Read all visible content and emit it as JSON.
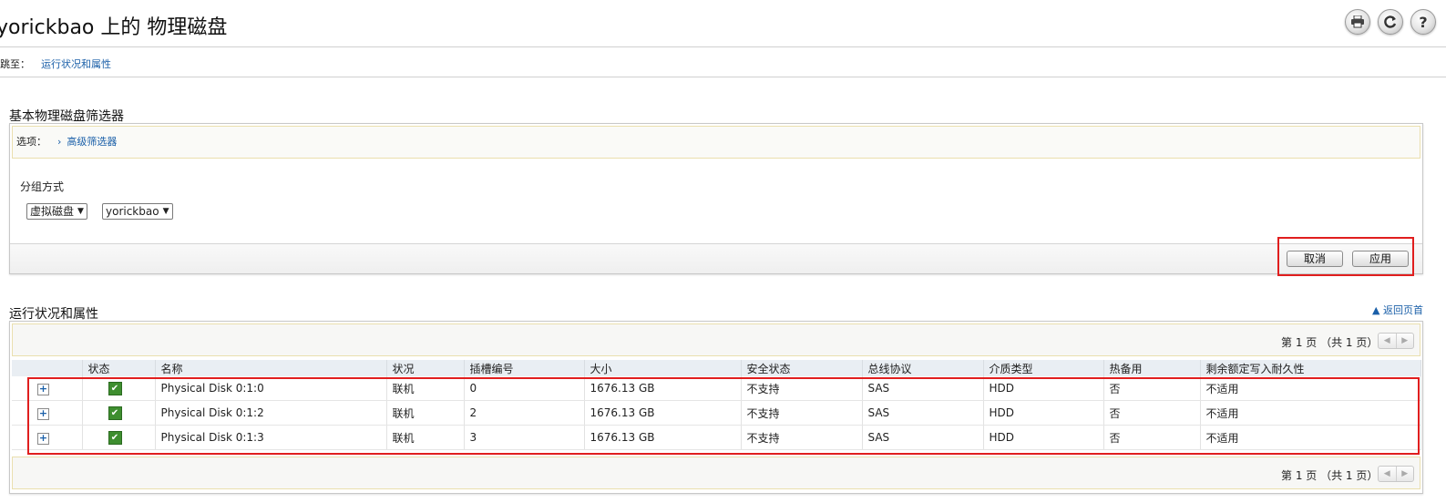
{
  "header": {
    "title": "yorickbao 上的 物理磁盘",
    "icons": [
      "printer-icon",
      "refresh-icon",
      "help-icon"
    ]
  },
  "jump": {
    "label": "跳至：",
    "link": "运行状况和属性"
  },
  "filter": {
    "title": "基本物理磁盘筛选器",
    "options_label": "选项：",
    "advanced_link": "高级筛选器",
    "group_label": "分组方式",
    "group_select": "虚拟磁盘",
    "disk_select": "yorickbao",
    "cancel_label": "取消",
    "apply_label": "应用"
  },
  "health": {
    "title": "运行状况和属性",
    "back_to_top": "▲ 返回页首",
    "pager_text": "第 1 页 （共 1 页）",
    "columns": [
      "",
      "状态",
      "名称",
      "状况",
      "插槽编号",
      "大小",
      "安全状态",
      "总线协议",
      "介质类型",
      "热备用",
      "剩余额定写入耐久性"
    ],
    "rows": [
      {
        "name": "Physical Disk 0:1:0",
        "state": "联机",
        "slot": "0",
        "size": "1676.13 GB",
        "security": "不支持",
        "bus": "SAS",
        "media": "HDD",
        "hotspare": "否",
        "endurance": "不适用"
      },
      {
        "name": "Physical Disk 0:1:2",
        "state": "联机",
        "slot": "2",
        "size": "1676.13 GB",
        "security": "不支持",
        "bus": "SAS",
        "media": "HDD",
        "hotspare": "否",
        "endurance": "不适用"
      },
      {
        "name": "Physical Disk 0:1:3",
        "state": "联机",
        "slot": "3",
        "size": "1676.13 GB",
        "security": "不支持",
        "bus": "SAS",
        "media": "HDD",
        "hotspare": "否",
        "endurance": "不适用"
      }
    ]
  },
  "colors": {
    "link": "#1a5fa8",
    "status_ok": "#3e8e2f",
    "highlight": "#e01e1e",
    "header_row": "#e9eef3"
  }
}
